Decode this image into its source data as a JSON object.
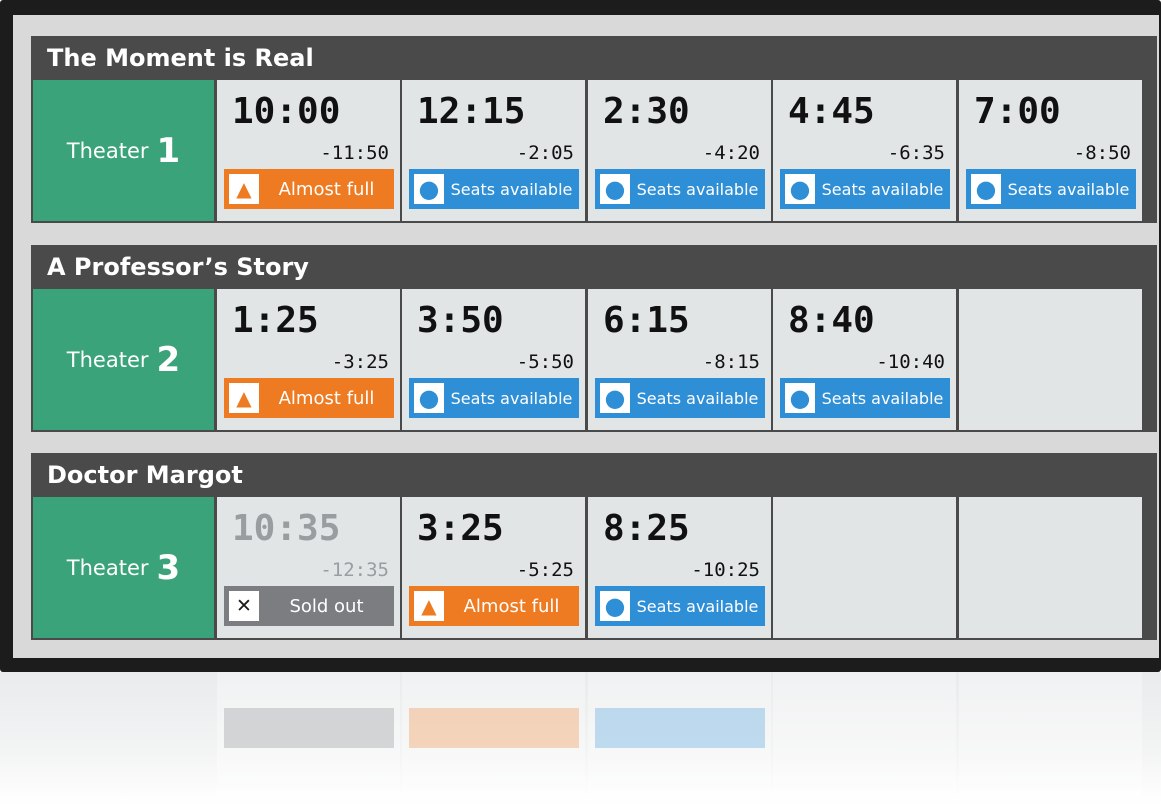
{
  "shows": [
    {
      "title": "The Moment is Real",
      "theater_word": "Theater",
      "theater_number": "1",
      "slots": [
        {
          "time": "10:00",
          "end": "-11:50",
          "status": "almost-full",
          "status_label": "Almost full",
          "icon": "triangle-icon",
          "glyph": "▲"
        },
        {
          "time": "12:15",
          "end": "-2:05",
          "status": "seats-available",
          "status_label": "Seats available",
          "icon": "circle-icon",
          "glyph": "●"
        },
        {
          "time": "2:30",
          "end": "-4:20",
          "status": "seats-available",
          "status_label": "Seats available",
          "icon": "circle-icon",
          "glyph": "●"
        },
        {
          "time": "4:45",
          "end": "-6:35",
          "status": "seats-available",
          "status_label": "Seats available",
          "icon": "circle-icon",
          "glyph": "●"
        },
        {
          "time": "7:00",
          "end": "-8:50",
          "status": "seats-available",
          "status_label": "Seats available",
          "icon": "circle-icon",
          "glyph": "●"
        }
      ]
    },
    {
      "title": "A Professor’s Story",
      "theater_word": "Theater",
      "theater_number": "2",
      "slots": [
        {
          "time": "1:25",
          "end": "-3:25",
          "status": "almost-full",
          "status_label": "Almost full",
          "icon": "triangle-icon",
          "glyph": "▲"
        },
        {
          "time": "3:50",
          "end": "-5:50",
          "status": "seats-available",
          "status_label": "Seats available",
          "icon": "circle-icon",
          "glyph": "●"
        },
        {
          "time": "6:15",
          "end": "-8:15",
          "status": "seats-available",
          "status_label": "Seats available",
          "icon": "circle-icon",
          "glyph": "●"
        },
        {
          "time": "8:40",
          "end": "-10:40",
          "status": "seats-available",
          "status_label": "Seats available",
          "icon": "circle-icon",
          "glyph": "●"
        },
        null
      ]
    },
    {
      "title": "Doctor Margot",
      "theater_word": "Theater",
      "theater_number": "3",
      "slots": [
        {
          "time": "10:35",
          "end": "-12:35",
          "status": "sold-out",
          "status_label": "Sold out",
          "icon": "close-icon",
          "glyph": "✕"
        },
        {
          "time": "3:25",
          "end": "-5:25",
          "status": "almost-full",
          "status_label": "Almost full",
          "icon": "triangle-icon",
          "glyph": "▲"
        },
        {
          "time": "8:25",
          "end": "-10:25",
          "status": "seats-available",
          "status_label": "Seats available",
          "icon": "circle-icon",
          "glyph": "●"
        },
        null,
        null
      ]
    }
  ],
  "colors": {
    "theater_green": "#3aa37a",
    "title_bar": "#4a4a4a",
    "almost_full": "#ee7a21",
    "seats_available": "#2f8fd6",
    "sold_out": "#7b7d80",
    "slot_bg": "#e1e5e6"
  }
}
